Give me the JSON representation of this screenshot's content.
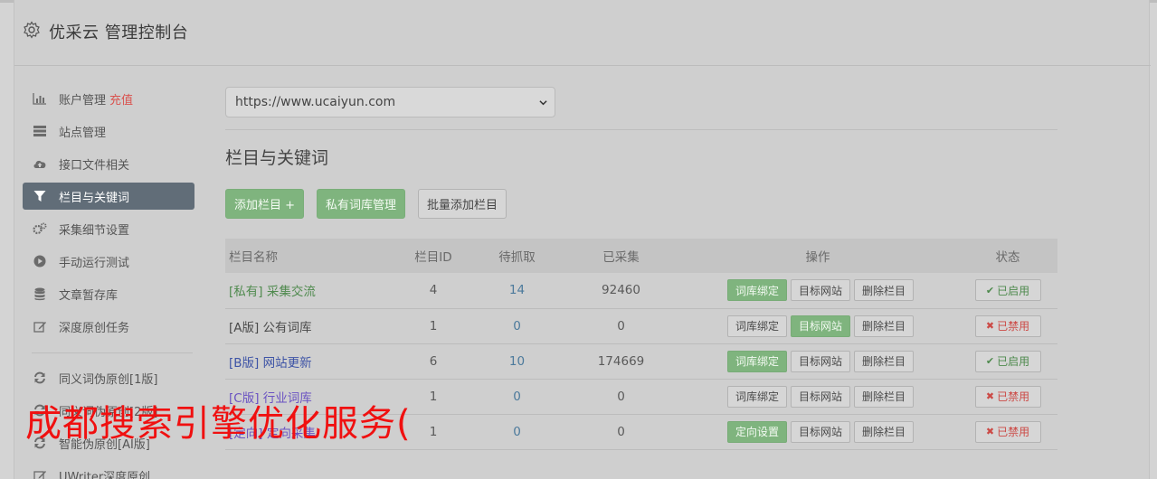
{
  "header": {
    "title": "优采云 管理控制台"
  },
  "sidebar": {
    "items": [
      {
        "label": "账户管理",
        "extra": "充值",
        "icon": "bar-chart-icon"
      },
      {
        "label": "站点管理",
        "icon": "server-icon"
      },
      {
        "label": "接口文件相关",
        "icon": "cloud-upload-icon"
      },
      {
        "label": "栏目与关键词",
        "icon": "filter-icon",
        "active": true
      },
      {
        "label": "采集细节设置",
        "icon": "cogs-icon"
      },
      {
        "label": "手动运行测试",
        "icon": "play-circle-icon"
      },
      {
        "label": "文章暂存库",
        "icon": "database-icon"
      },
      {
        "label": "深度原创任务",
        "icon": "edit-icon"
      }
    ],
    "items2": [
      {
        "label": "同义词伪原创[1版]",
        "icon": "refresh-icon"
      },
      {
        "label": "同义词伪原创[2版]",
        "icon": "refresh-icon"
      },
      {
        "label": "智能伪原创[AI版]",
        "icon": "refresh-icon"
      },
      {
        "label": "UWriter深度原创",
        "icon": "edit-icon"
      }
    ]
  },
  "main": {
    "site_select": "https://www.ucaiyun.com",
    "section_title": "栏目与关键词",
    "buttons": {
      "add": "添加栏目 +",
      "private_lib": "私有词库管理",
      "batch_add": "批量添加栏目"
    },
    "table": {
      "headers": [
        "栏目名称",
        "栏目ID",
        "待抓取",
        "已采集",
        "操作",
        "状态"
      ],
      "rows": [
        {
          "name": "[私有] 采集交流",
          "id": "4",
          "pending": "14",
          "collected": "92460",
          "op1": "词库绑定",
          "op2": "目标网站",
          "op3": "删除栏目",
          "status": "已启用"
        },
        {
          "name": "[A版] 公有词库",
          "id": "1",
          "pending": "0",
          "collected": "0",
          "op1": "词库绑定",
          "op2": "目标网站",
          "op3": "删除栏目",
          "status": "已禁用"
        },
        {
          "name": "[B版] 网站更新",
          "id": "6",
          "pending": "10",
          "collected": "174669",
          "op1": "词库绑定",
          "op2": "目标网站",
          "op3": "删除栏目",
          "status": "已启用"
        },
        {
          "name": "[C版] 行业词库",
          "id": "1",
          "pending": "0",
          "collected": "0",
          "op1": "词库绑定",
          "op2": "目标网站",
          "op3": "删除栏目",
          "status": "已禁用"
        },
        {
          "name": "[定向] 定向采集",
          "id": "1",
          "pending": "0",
          "collected": "0",
          "op1": "定向设置",
          "op2": "目标网站",
          "op3": "删除栏目",
          "status": "已禁用"
        }
      ]
    }
  },
  "watermark": "成都搜索引擎优化服务("
}
